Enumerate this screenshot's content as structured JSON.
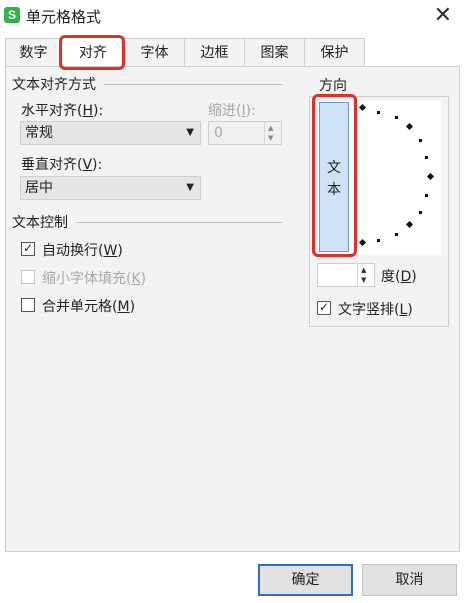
{
  "window": {
    "title": "单元格格式",
    "app_icon_letter": "S",
    "close_glyph": "✕"
  },
  "tabs": [
    {
      "label": "数字",
      "active": false
    },
    {
      "label": "对齐",
      "active": true
    },
    {
      "label": "字体",
      "active": false
    },
    {
      "label": "边框",
      "active": false
    },
    {
      "label": "图案",
      "active": false
    },
    {
      "label": "保护",
      "active": false
    }
  ],
  "text_alignment": {
    "heading": "文本对齐方式",
    "horizontal": {
      "label_pre": "水平对齐(",
      "key": "H",
      "label_post": "):",
      "value": "常规"
    },
    "indent": {
      "label_pre": "缩进(",
      "key": "I",
      "label_post": "):",
      "value": "0"
    },
    "vertical": {
      "label_pre": "垂直对齐(",
      "key": "V",
      "label_post": "):",
      "value": "居中"
    }
  },
  "text_control": {
    "heading": "文本控制",
    "wrap": {
      "label_pre": "自动换行(",
      "key": "W",
      "label_post": ")",
      "checked": true
    },
    "shrink": {
      "label_pre": "缩小字体填充(",
      "key": "K",
      "label_post": ")",
      "checked": false
    },
    "merge": {
      "label_pre": "合并单元格(",
      "key": "M",
      "label_post": ")",
      "checked": false
    }
  },
  "orientation": {
    "heading": "方向",
    "vertical_text": [
      "文",
      "本"
    ],
    "degree": {
      "value": "",
      "label_pre": "度(",
      "key": "D",
      "label_post": ")"
    },
    "vertical_stack": {
      "label_pre": "文字竖排(",
      "key": "L",
      "label_post": ")",
      "checked": true
    }
  },
  "buttons": {
    "ok": "确定",
    "cancel": "取消"
  },
  "colors": {
    "highlight": "#e0302a",
    "accent": "#2e6fbe",
    "vertical_text_bg": "#cfe2f7"
  }
}
